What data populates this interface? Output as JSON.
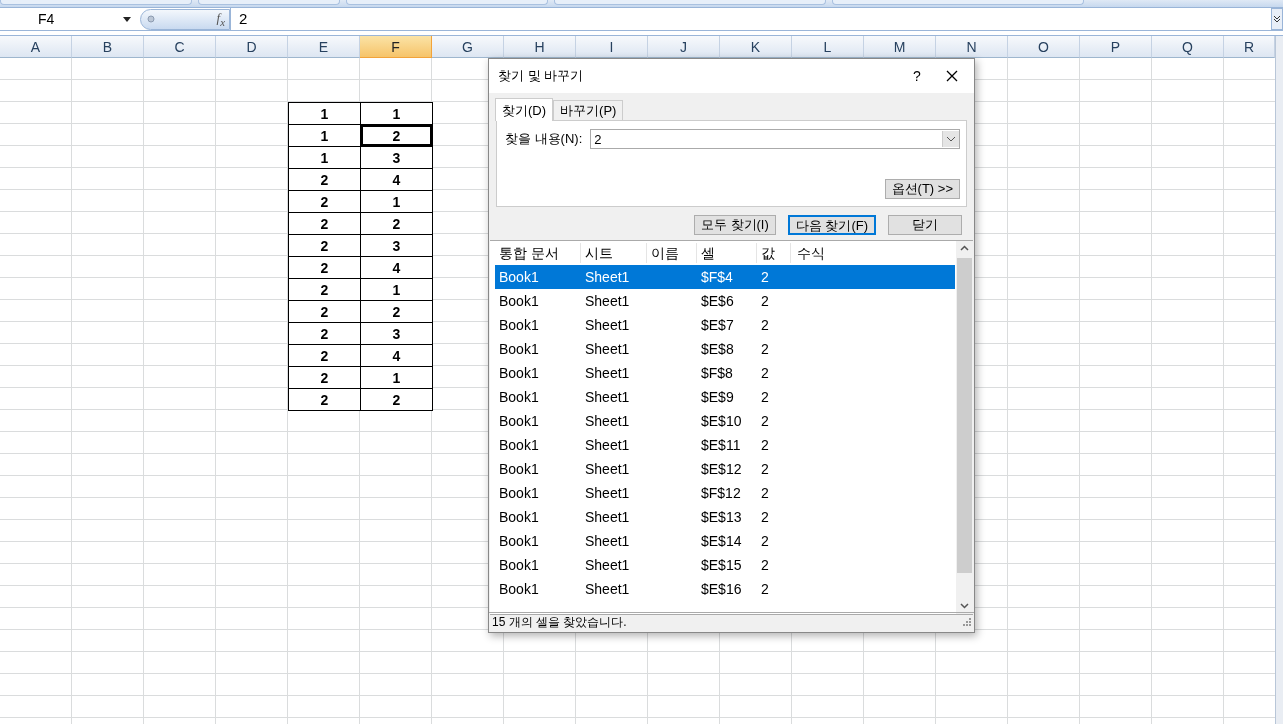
{
  "formula_bar": {
    "name_box": "F4",
    "function_label": "f$_{x}$",
    "formula": "2"
  },
  "columns": [
    {
      "label": "A",
      "selected": false
    },
    {
      "label": "B",
      "selected": false
    },
    {
      "label": "C",
      "selected": false
    },
    {
      "label": "D",
      "selected": false
    },
    {
      "label": "E",
      "selected": false
    },
    {
      "label": "F",
      "selected": true
    },
    {
      "label": "G",
      "selected": false
    },
    {
      "label": "H",
      "selected": false
    },
    {
      "label": "I",
      "selected": false
    },
    {
      "label": "J",
      "selected": false
    },
    {
      "label": "K",
      "selected": false
    },
    {
      "label": "L",
      "selected": false
    },
    {
      "label": "M",
      "selected": false
    },
    {
      "label": "N",
      "selected": false
    },
    {
      "label": "O",
      "selected": false
    },
    {
      "label": "P",
      "selected": false
    },
    {
      "label": "Q",
      "selected": false
    },
    {
      "label": "R",
      "selected": false
    }
  ],
  "table": {
    "rows": [
      [
        {
          "text": "1",
          "selected": false
        },
        {
          "text": "1",
          "selected": false
        }
      ],
      [
        {
          "text": "1",
          "selected": false
        },
        {
          "text": "2",
          "selected": true
        }
      ],
      [
        {
          "text": "1",
          "selected": false
        },
        {
          "text": "3",
          "selected": false
        }
      ],
      [
        {
          "text": "2",
          "selected": false
        },
        {
          "text": "4",
          "selected": false
        }
      ],
      [
        {
          "text": "2",
          "selected": false
        },
        {
          "text": "1",
          "selected": false
        }
      ],
      [
        {
          "text": "2",
          "selected": false
        },
        {
          "text": "2",
          "selected": false
        }
      ],
      [
        {
          "text": "2",
          "selected": false
        },
        {
          "text": "3",
          "selected": false
        }
      ],
      [
        {
          "text": "2",
          "selected": false
        },
        {
          "text": "4",
          "selected": false
        }
      ],
      [
        {
          "text": "2",
          "selected": false
        },
        {
          "text": "1",
          "selected": false
        }
      ],
      [
        {
          "text": "2",
          "selected": false
        },
        {
          "text": "2",
          "selected": false
        }
      ],
      [
        {
          "text": "2",
          "selected": false
        },
        {
          "text": "3",
          "selected": false
        }
      ],
      [
        {
          "text": "2",
          "selected": false
        },
        {
          "text": "4",
          "selected": false
        }
      ],
      [
        {
          "text": "2",
          "selected": false
        },
        {
          "text": "1",
          "selected": false
        }
      ],
      [
        {
          "text": "2",
          "selected": false
        },
        {
          "text": "2",
          "selected": false
        }
      ]
    ]
  },
  "dialog": {
    "title": "찾기 및 바꾸기",
    "help": "?",
    "tabs": [
      {
        "label": "찾기(D)",
        "selected": true
      },
      {
        "label": "바꾸기(P)",
        "selected": false
      }
    ],
    "find_label": "찾을 내용(N):",
    "find_value": "2",
    "options_button": "옵션(T) >>",
    "buttons": [
      {
        "label": "모두 찾기(I)",
        "default": false
      },
      {
        "label": "다음 찾기(F)",
        "default": true
      },
      {
        "label": "닫기",
        "default": false
      }
    ],
    "results": {
      "columns": [
        "통합 문서",
        "시트",
        "이름",
        "셀",
        "값",
        "수식"
      ],
      "rows": [
        {
          "cells": [
            "Book1",
            "Sheet1",
            "",
            "$F$4",
            "2",
            ""
          ],
          "selected": true
        },
        {
          "cells": [
            "Book1",
            "Sheet1",
            "",
            "$E$6",
            "2",
            ""
          ],
          "selected": false
        },
        {
          "cells": [
            "Book1",
            "Sheet1",
            "",
            "$E$7",
            "2",
            ""
          ],
          "selected": false
        },
        {
          "cells": [
            "Book1",
            "Sheet1",
            "",
            "$E$8",
            "2",
            ""
          ],
          "selected": false
        },
        {
          "cells": [
            "Book1",
            "Sheet1",
            "",
            "$F$8",
            "2",
            ""
          ],
          "selected": false
        },
        {
          "cells": [
            "Book1",
            "Sheet1",
            "",
            "$E$9",
            "2",
            ""
          ],
          "selected": false
        },
        {
          "cells": [
            "Book1",
            "Sheet1",
            "",
            "$E$10",
            "2",
            ""
          ],
          "selected": false
        },
        {
          "cells": [
            "Book1",
            "Sheet1",
            "",
            "$E$11",
            "2",
            ""
          ],
          "selected": false
        },
        {
          "cells": [
            "Book1",
            "Sheet1",
            "",
            "$E$12",
            "2",
            ""
          ],
          "selected": false
        },
        {
          "cells": [
            "Book1",
            "Sheet1",
            "",
            "$F$12",
            "2",
            ""
          ],
          "selected": false
        },
        {
          "cells": [
            "Book1",
            "Sheet1",
            "",
            "$E$13",
            "2",
            ""
          ],
          "selected": false
        },
        {
          "cells": [
            "Book1",
            "Sheet1",
            "",
            "$E$14",
            "2",
            ""
          ],
          "selected": false
        },
        {
          "cells": [
            "Book1",
            "Sheet1",
            "",
            "$E$15",
            "2",
            ""
          ],
          "selected": false
        },
        {
          "cells": [
            "Book1",
            "Sheet1",
            "",
            "$E$16",
            "2",
            ""
          ],
          "selected": false
        }
      ]
    },
    "status": "15 개의 셀을 찾았습니다."
  }
}
